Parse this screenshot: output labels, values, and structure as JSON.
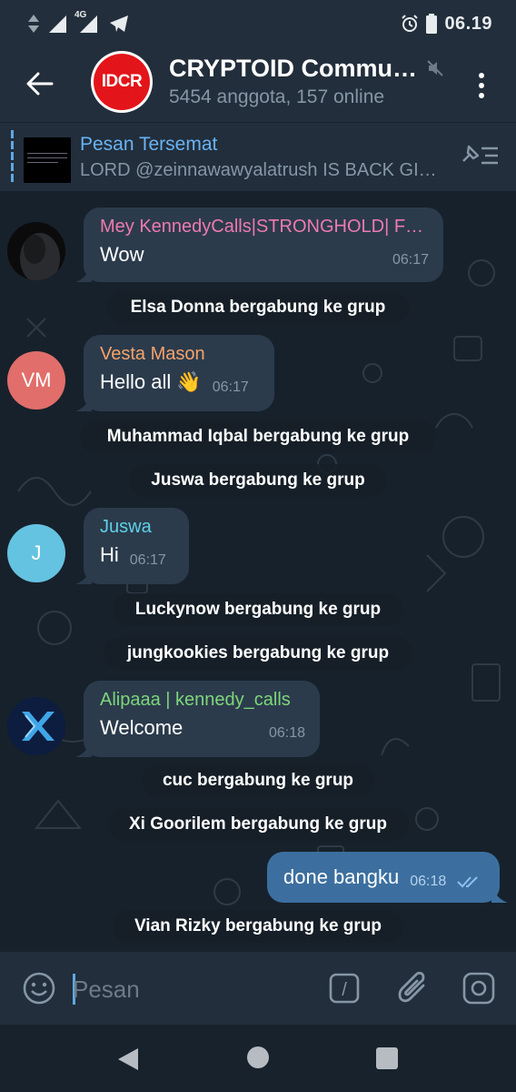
{
  "status_bar": {
    "network": "4G",
    "time": "06.19"
  },
  "header": {
    "avatar_logo": "IDCR",
    "title": "CRYPTOID Commun…",
    "subtitle": "5454 anggota, 157 online"
  },
  "pinned": {
    "title": "Pesan Tersemat",
    "text": "LORD @zeinnawawyalatrush IS BACK GI…"
  },
  "messages": [
    {
      "sender": "Mey KennedyCalls|STRONGHOLD| F…",
      "sender_color": "#ee7aae",
      "text": "Wow",
      "time": "06:17"
    },
    {
      "service": "Elsa Donna bergabung ke grup"
    },
    {
      "avatar_initials": "VM",
      "avatar_color": "#e16e6a",
      "sender": "Vesta Mason",
      "sender_color": "#f5a36a",
      "text": "Hello all 👋",
      "time": "06:17"
    },
    {
      "service": "Muhammad Iqbal bergabung ke grup"
    },
    {
      "service": "Juswa bergabung ke grup"
    },
    {
      "avatar_initials": "J",
      "avatar_color": "#64c3e0",
      "sender": "Juswa",
      "sender_color": "#5fd1e8",
      "text": "Hi",
      "time": "06:17"
    },
    {
      "service": "Luckynow bergabung ke grup"
    },
    {
      "service": "jungkookies bergabung ke grup"
    },
    {
      "sender": "Alipaaa | kennedy_calls",
      "sender_color": "#7ed67a",
      "text": "Welcome",
      "time": "06:18"
    },
    {
      "service": "cuc bergabung ke grup"
    },
    {
      "service": "Xi Goorilem bergabung ke grup"
    },
    {
      "outgoing": true,
      "text": "done bangku",
      "time": "06:18"
    },
    {
      "service": "Vian Rizky bergabung ke grup"
    }
  ],
  "input": {
    "placeholder": "Pesan",
    "command_symbol": "/"
  },
  "colors": {
    "accent": "#5fa8e3",
    "incoming_bubble": "#2b3b4c",
    "outgoing_bubble": "#3c6f9f",
    "background": "#17212b"
  }
}
